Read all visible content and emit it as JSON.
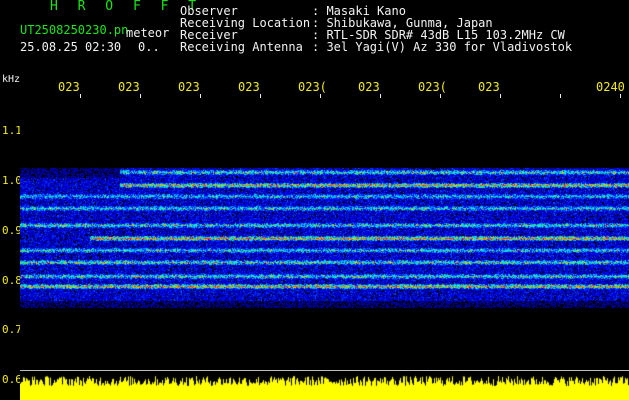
{
  "header": {
    "brand": "H R O F F T",
    "filename": "UT2508250230.pn",
    "filename_suffix": "meteor",
    "datetime": "25.08.25 02:30",
    "counter": "0.."
  },
  "meta": {
    "rows": [
      {
        "label": "Observer",
        "value": ": Masaki Kano"
      },
      {
        "label": "Receiving Location",
        "value": ": Shibukawa, Gunma, Japan"
      },
      {
        "label": "Receiver",
        "value": ": RTL-SDR SDR# 43dB L15 103.2MHz CW"
      },
      {
        "label": "Receiving Antenna",
        "value": ": 3el Yagi(V) Az 330 for Vladivostok"
      }
    ]
  },
  "axis": {
    "unit": "kHz",
    "y_ticks": [
      "1.1",
      "1.0",
      "0.9",
      "0.8",
      "0.7",
      "0.6"
    ],
    "x_ticks": [
      "023",
      "023",
      "023",
      "023",
      "023(",
      "023",
      "023(",
      "023",
      "0240"
    ]
  },
  "colors": {
    "background": "#000000",
    "header_green": "#19e619",
    "tick_yellow": "#f2ea1a",
    "level_yellow": "#ffff00"
  }
}
